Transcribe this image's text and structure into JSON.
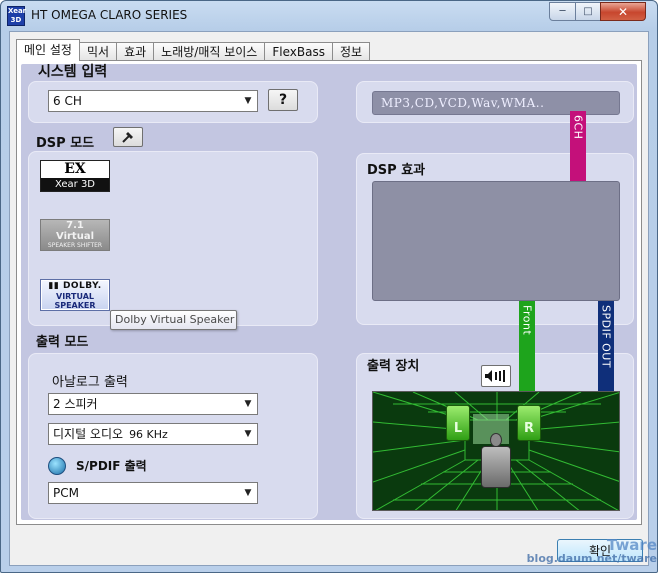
{
  "window": {
    "title": "HT OMEGA CLARO SERIES",
    "icon_text": "Xear 3D"
  },
  "tabs": [
    {
      "label": "메인 설정",
      "active": true
    },
    {
      "label": "믹서",
      "active": false
    },
    {
      "label": "효과",
      "active": false
    },
    {
      "label": "노래방/매직 보이스",
      "active": false
    },
    {
      "label": "FlexBass",
      "active": false
    },
    {
      "label": "정보",
      "active": false
    }
  ],
  "system_input": {
    "label": "시스템 입력",
    "channel_select": "6 CH",
    "help_button": "?",
    "source_readout": "MP3,CD,VCD,Wav,WMA.."
  },
  "dsp_mode": {
    "label": "DSP 모드",
    "xear": {
      "line1": "EX",
      "line2": "Xear 3D"
    },
    "virtual71": {
      "line1": "7.1",
      "line2": "Virtual",
      "line3": "SPEAKER SHIFTER"
    },
    "dolby": {
      "line1": "DOLBY.",
      "line2": "VIRTUAL",
      "line3": "SPEAKER"
    },
    "tooltip": "Dolby Virtual Speaker"
  },
  "dsp_effect": {
    "label": "DSP 효과"
  },
  "signal_paths": {
    "channel_6ch": "6CH",
    "front": "Front",
    "spdif_out": "SPDIF OUT",
    "colors": {
      "magenta": "#c4107a",
      "green": "#1ea41c",
      "navy": "#0f2f7a"
    }
  },
  "output_mode": {
    "label": "출력 모드",
    "analog_label": "아날로그 출력",
    "analog_select": "2 스피커",
    "digital_select": "디지털 오디오",
    "digital_rate": "96 KHz",
    "spdif_label": "S/PDIF 출력",
    "spdif_select": "PCM"
  },
  "output_device": {
    "label": "출력 장치",
    "left_speaker": "L",
    "right_speaker": "R"
  },
  "footer": {
    "ok_button": "확인",
    "watermark_line1": "Tware",
    "watermark_line2": "blog.daum.net/tware"
  }
}
